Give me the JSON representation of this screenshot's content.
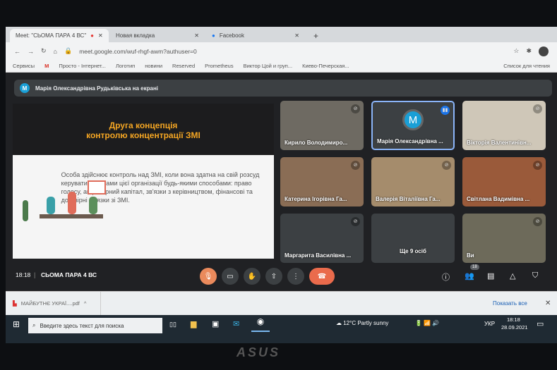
{
  "browser": {
    "tabs": [
      {
        "label": "Meet: \"СЬОМА ПАРА 4 ВС\""
      },
      {
        "label": "Новая вкладка"
      },
      {
        "label": "Facebook"
      }
    ],
    "url": "meet.google.com/wuf-rhgf-awm?authuser=0",
    "reading_list": "Список для чтения",
    "bookmarks": [
      "Сервисы",
      "Просто - Інтернет...",
      "Логотип",
      "новини",
      "Reserved",
      "Prometheus",
      "Виктор Цой и груп...",
      "Киево-Печерская..."
    ]
  },
  "meet": {
    "banner_avatar": "M",
    "banner": "Марія Олександрівна Рудьківська на екрані",
    "slide": {
      "title1": "Друга концепція",
      "title2": "контролю концентрації ЗМІ",
      "text": "Особа здійснює контроль над ЗМІ, коли вона здатна на свій розсуд керувати справами цієї організації будь-якими способами: право голосу, акціонерний капітал, зв'язки з керівництвом, фінансові та договірні зв'язки зі ЗМІ."
    },
    "tiles": [
      {
        "name": "Кирило Володимиро..."
      },
      {
        "name": "Марія Олександрівна ...",
        "avatar": "M"
      },
      {
        "name": "Вікторія Валентинівн..."
      },
      {
        "name": "Катерина Ігорівна Га..."
      },
      {
        "name": "Валерія Віталіївна Га..."
      },
      {
        "name": "Світлана Вадимівна ..."
      },
      {
        "name": "Маргарита Василівна ..."
      },
      {
        "name": "Ще 9 осіб"
      },
      {
        "name": "Ви"
      }
    ],
    "time": "18:18",
    "meeting_name": "СЬОМА ПАРА 4 ВС",
    "participants_count": "18"
  },
  "downloads": {
    "file": "МАЙБУТНЄ УКРАЇ....pdf",
    "show_all": "Показать все"
  },
  "taskbar": {
    "search_placeholder": "Введите здесь текст для поиска",
    "weather": "12°C  Partly sunny",
    "lang": "УКР",
    "time": "18:18",
    "date": "28.09.2021"
  },
  "bezel": {
    "logo": "ASUS"
  }
}
